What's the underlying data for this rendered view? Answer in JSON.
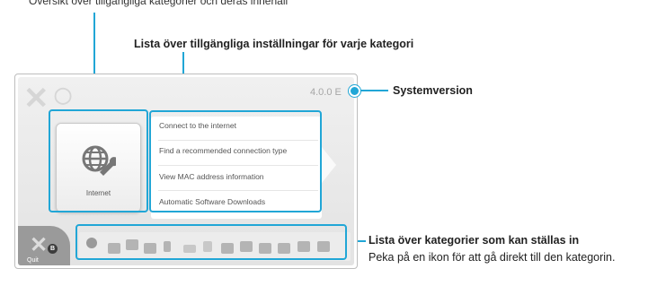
{
  "top_annotation": "Översikt över tillgängliga kategorier och deras innehåll",
  "labels": {
    "settings_list": "Lista över tillgängliga inställningar för varje kategori",
    "system_version": "Systemversion",
    "categories_list_title": "Lista över kategorier som kan ställas in",
    "categories_list_desc": "Peka på en ikon för att gå direkt till den kategorin."
  },
  "screen": {
    "version": "4.0.0 E",
    "category": {
      "name": "Internet",
      "icon": "globe-wrench-icon"
    },
    "settings": [
      "Connect to the internet",
      "Find a recommended connection type",
      "View MAC address information",
      "Automatic Software Downloads"
    ],
    "quit": {
      "button": "B",
      "label": "Quit"
    },
    "category_icons": [
      "globe-wrench-icon",
      "console-icon",
      "data-management-icon",
      "screen-icon",
      "controller-icon",
      "tv-icon",
      "microphone-icon",
      "tools-icon",
      "parental-icon",
      "users-icon",
      "camera-icon",
      "download-icon",
      "users-lock-icon"
    ]
  },
  "colors": {
    "callout": "#21a6d6"
  }
}
